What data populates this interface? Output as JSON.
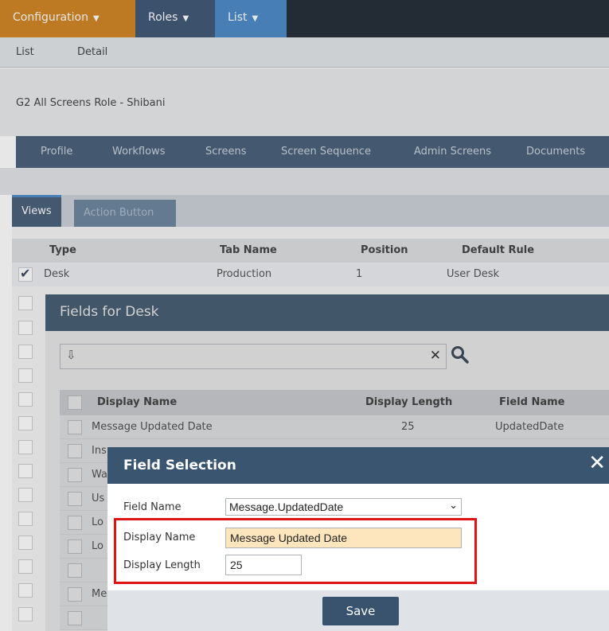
{
  "topnav": {
    "tabs": [
      {
        "label": "Configuration"
      },
      {
        "label": "Roles"
      },
      {
        "label": "List"
      }
    ]
  },
  "subnav": {
    "items": [
      "List",
      "Detail"
    ]
  },
  "role_title": "G2 All Screens Role - Shibani",
  "profile_tabs": [
    "Profile",
    "Workflows",
    "Screens",
    "Screen Sequence",
    "Admin Screens",
    "Documents"
  ],
  "view_tabs": [
    "Views",
    "Action Button"
  ],
  "grid": {
    "headers": [
      "Type",
      "Tab Name",
      "Position",
      "Default Rule"
    ],
    "row1": {
      "type": "Desk",
      "tab_name": "Production",
      "position": "1",
      "default_rule": "User Desk"
    }
  },
  "fields_modal": {
    "title": "Fields for Desk",
    "headers": [
      "Display Name",
      "Display Length",
      "Field Name"
    ],
    "rows": [
      {
        "display_name": "Message Updated Date",
        "display_length": "25",
        "field_name": "UpdatedDate"
      },
      {
        "display_name": "Ins"
      },
      {
        "display_name": "Wa"
      },
      {
        "display_name": "Us"
      },
      {
        "display_name": "Lo"
      },
      {
        "display_name": "Lo"
      },
      {
        "display_name": ""
      },
      {
        "display_name": "Me"
      }
    ]
  },
  "field_selection": {
    "title": "Field Selection",
    "field_name_label": "Field Name",
    "field_name_value": "Message.UpdatedDate",
    "display_name_label": "Display Name",
    "display_name_value": "Message Updated Date",
    "display_length_label": "Display Length",
    "display_length_value": "25",
    "save_label": "Save"
  },
  "colors": {
    "nav_dark": "#111c26",
    "config_tab": "#cc7a10",
    "roles_tab": "#2f4a6a",
    "list_tab": "#3c7fc4",
    "modal_header": "#3a5570",
    "highlight_border": "#e01414",
    "display_name_fill": "#fde6bd"
  }
}
